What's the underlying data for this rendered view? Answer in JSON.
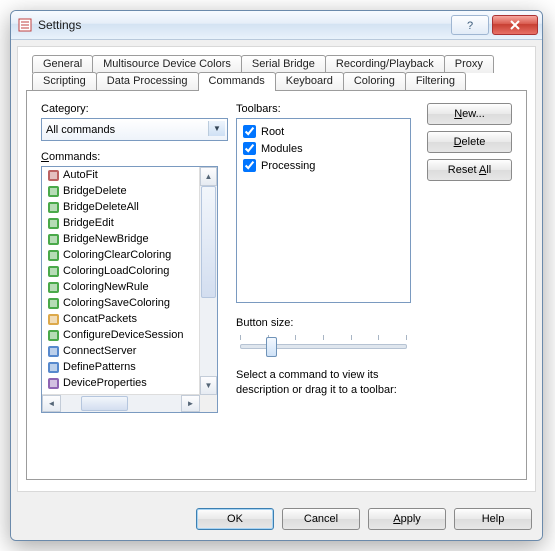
{
  "window": {
    "title": "Settings"
  },
  "tabs_row1": [
    "General",
    "Multisource Device Colors",
    "Serial Bridge",
    "Recording/Playback",
    "Proxy"
  ],
  "tabs_row2": [
    "Scripting",
    "Data Processing",
    "Commands",
    "Keyboard",
    "Coloring",
    "Filtering"
  ],
  "active_tab": "Commands",
  "left": {
    "category_label": "Category:",
    "category_value": "All commands",
    "commands_label": "Commands:",
    "items": [
      {
        "label": "AutoFit",
        "c": "#b04848"
      },
      {
        "label": "BridgeDelete",
        "c": "#2a9a2a"
      },
      {
        "label": "BridgeDeleteAll",
        "c": "#2a9a2a"
      },
      {
        "label": "BridgeEdit",
        "c": "#2a9a2a"
      },
      {
        "label": "BridgeNewBridge",
        "c": "#2a9a2a"
      },
      {
        "label": "ColoringClearColoring",
        "c": "#2a9a2a"
      },
      {
        "label": "ColoringLoadColoring",
        "c": "#2a9a2a"
      },
      {
        "label": "ColoringNewRule",
        "c": "#2a9a2a"
      },
      {
        "label": "ColoringSaveColoring",
        "c": "#2a9a2a"
      },
      {
        "label": "ConcatPackets",
        "c": "#d79a2b"
      },
      {
        "label": "ConfigureDeviceSession",
        "c": "#2a9a2a"
      },
      {
        "label": "ConnectServer",
        "c": "#3a74c4"
      },
      {
        "label": "DefinePatterns",
        "c": "#3a74c4"
      },
      {
        "label": "DeviceProperties",
        "c": "#7a4aa6"
      }
    ]
  },
  "mid": {
    "toolbars_label": "Toolbars:",
    "toolbars": [
      {
        "label": "Root",
        "checked": true
      },
      {
        "label": "Modules",
        "checked": true
      },
      {
        "label": "Processing",
        "checked": true
      }
    ],
    "button_size_label": "Button size:",
    "description": "Select a command to view its description or drag it to a toolbar:"
  },
  "buttons": {
    "new": "New...",
    "delete": "Delete",
    "reset_all": "Reset All"
  },
  "dlg": {
    "ok": "OK",
    "cancel": "Cancel",
    "apply": "Apply",
    "help": "Help"
  }
}
